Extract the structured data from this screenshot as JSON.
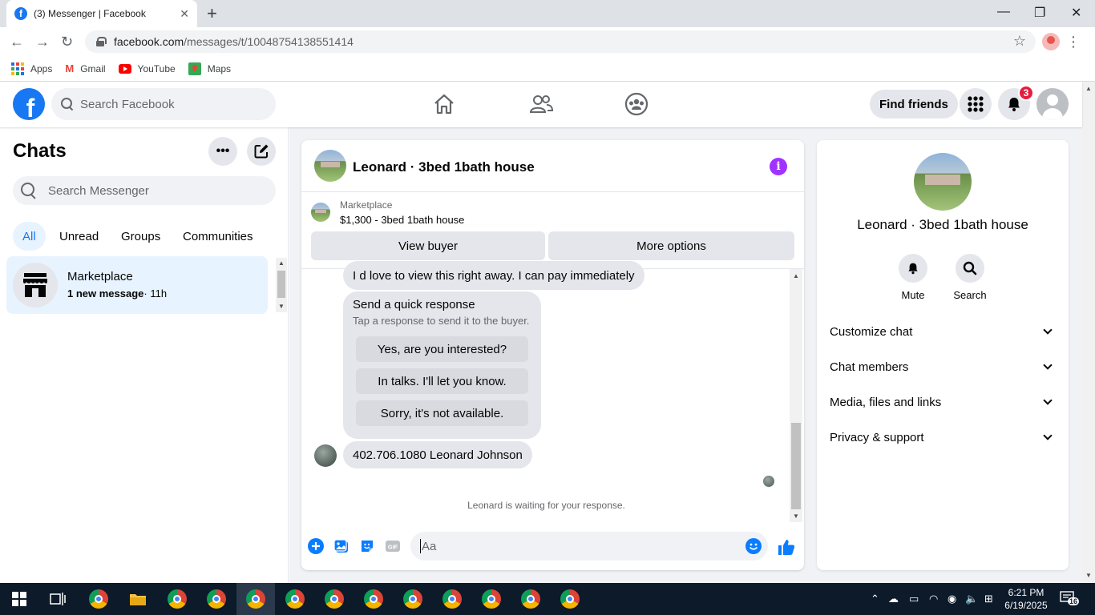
{
  "browser": {
    "tab_title": "(3) Messenger | Facebook",
    "tab_fav": "f",
    "tab_close": "✕",
    "new_tab": "+",
    "url_host": "facebook.com",
    "url_path": "/messages/t/10048754138551414",
    "bookmarks": [
      {
        "label": "Apps",
        "icon": "apps-grid-icon"
      },
      {
        "label": "Gmail",
        "icon": "gmail-icon"
      },
      {
        "label": "YouTube",
        "icon": "youtube-icon"
      },
      {
        "label": "Maps",
        "icon": "maps-icon"
      }
    ]
  },
  "fb": {
    "logo": "f",
    "search_placeholder": "Search Facebook",
    "find_friends": "Find friends",
    "notif_count": "3"
  },
  "chats": {
    "title": "Chats",
    "search_placeholder": "Search Messenger",
    "filters": [
      "All",
      "Unread",
      "Groups",
      "Communities"
    ],
    "active_filter": "All",
    "items": [
      {
        "name": "Marketplace",
        "new": "1 new message",
        "time": "· 11h"
      }
    ]
  },
  "conversation": {
    "title": "Leonard · 3bed 1bath house",
    "marketplace_label": "Marketplace",
    "listing": "$1,300 - 3bed 1bath house",
    "view_buyer": "View buyer",
    "more_options": "More options",
    "msg1": "I d love to view this right away. I can pay immediately",
    "quick_title": "Send a quick response",
    "quick_sub": "Tap a response to send it to the buyer.",
    "quick_options": [
      "Yes, are you interested?",
      "In talks. I'll let you know.",
      "Sorry, it's not available."
    ],
    "msg2": "402.706.1080 Leonard Johnson",
    "waiting": "Leonard is waiting for your response.",
    "composer_placeholder": "Aa"
  },
  "details": {
    "name": "Leonard · 3bed 1bath house",
    "actions": [
      {
        "label": "Mute",
        "icon": "bell-icon"
      },
      {
        "label": "Search",
        "icon": "search-icon"
      }
    ],
    "sections": [
      "Customize chat",
      "Chat members",
      "Media, files and links",
      "Privacy & support"
    ]
  },
  "taskbar": {
    "time": "6:21 PM",
    "date": "6/19/2025",
    "notif_count": "16"
  },
  "colors": {
    "brand": "#1877f2",
    "info_purple": "#a033ff",
    "badge_red": "#e41e3f"
  }
}
